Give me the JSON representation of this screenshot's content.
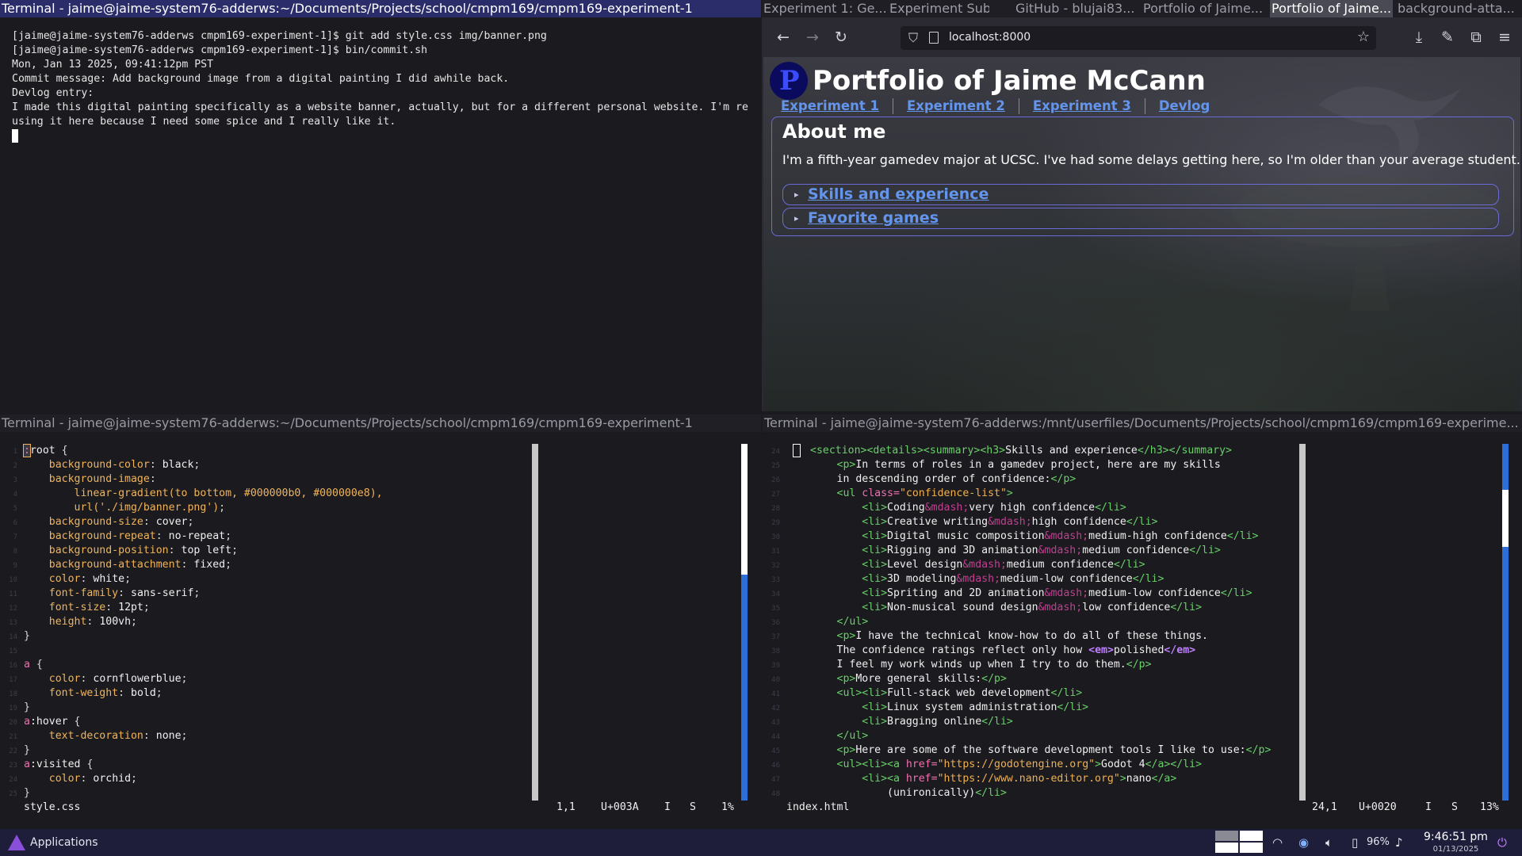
{
  "term1": {
    "title": "Terminal - jaime@jaime-system76-adderws:~/Documents/Projects/school/cmpm169/cmpm169-experiment-1",
    "lines": [
      "[jaime@jaime-system76-adderws cmpm169-experiment-1]$ git add style.css img/banner.png",
      "[jaime@jaime-system76-adderws cmpm169-experiment-1]$ bin/commit.sh",
      "Mon, Jan 13 2025, 09:41:12pm PST",
      "Commit message: Add background image from a digital painting I did awhile back.",
      "Devlog entry:",
      "I made this digital painting specifically as a website banner, actually, but for a different personal website. I'm reusing it here because I need some spice and I really like it."
    ]
  },
  "browser": {
    "tabs": [
      "Experiment 1: Ge...",
      "Experiment Sub...",
      "GitHub - blujai83...",
      "Portfolio of Jaime...",
      "Portfolio of Jaime...",
      "background-atta..."
    ],
    "url": "localhost:8000",
    "page": {
      "title": "Portfolio of Jaime McCann",
      "nav": [
        "Experiment 1",
        "Experiment 2",
        "Experiment 3",
        "Devlog"
      ],
      "about_heading": "About me",
      "about_text": "I'm a fifth-year gamedev major at UCSC. I've had some delays getting here, so I'm older than your average student.",
      "details": [
        "Skills and experience",
        "Favorite games"
      ]
    }
  },
  "editor_css": {
    "title": "Terminal - jaime@jaime-system76-adderws:~/Documents/Projects/school/cmpm169/cmpm169-experiment-1",
    "status_file": "style.css",
    "status_pos": "1,1",
    "status_char": "U+003A",
    "status_mode": "I",
    "status_s": "S",
    "status_pct": "1%"
  },
  "editor_html": {
    "title": "Terminal - jaime@jaime-system76-adderws:/mnt/userfiles/Documents/Projects/school/cmpm169/cmpm169-experime...",
    "status_file": "index.html",
    "status_pos": "24,1",
    "status_char": "U+0020",
    "status_mode": "I",
    "status_s": "S",
    "status_pct": "13%"
  },
  "taskbar": {
    "apps_label": "Applications",
    "battery": "96%",
    "time": "9:46:51 pm",
    "date": "01/13/2025"
  },
  "colors": {
    "active_title_bg": "#2b2d6a",
    "link": "#6495ed",
    "css_property": "#f2b45a",
    "html_tag": "#6ad06a",
    "scroll_blue": "#2d6fd6"
  }
}
